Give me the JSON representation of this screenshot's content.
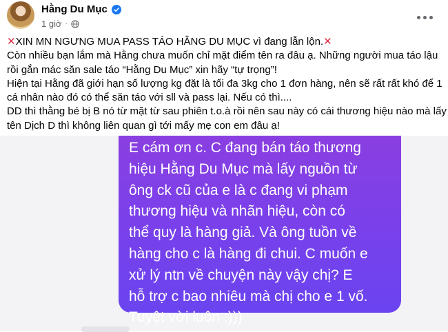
{
  "post": {
    "author": "Hằng Du Mục",
    "time": "1 giờ",
    "privacy_icon": "globe-icon",
    "more_icon": "more-options-icon",
    "lines": [
      "XIN MN NGƯNG MUA PASS TÁO HẰNG DU MỤC vì đang lẫn lộn.",
      "Còn nhiều bạn lắm mà Hằng chưa muốn chỉ mặt điểm tên ra đâu ạ. Những người mua táo lậu",
      "rồi gắn mác săn sale táo “Hằng Du Mục” xin hãy “tự trọng”!",
      "Hiện tại Hằng đã giới hạn số lượng kg đặt là tối đa 3kg cho 1 đơn hàng, nên sẽ rất rất khó để 1",
      "cá nhân nào đó có thể săn táo với sll và pass lại. Nếu có thì....",
      "DD thì thằng bé bị B nó từ mặt từ sau phiên t.o.à rồi nên sau này có cái thương hiệu nào mà lấy",
      "tên Dịch D thì không liên quan gì tới mấy mẹ con em đâu ạ!"
    ]
  },
  "message": {
    "lines": [
      "E cám ơn c. C đang bán táo thương",
      "hiệu Hằng Du Mục mà lấy nguồn từ",
      "ông ck cũ của e là c đang vi phạm",
      "thương hiệu và nhãn hiệu, còn có",
      "thể quy là hàng giả. Và ông tuồn về",
      "hàng cho c là hàng đi chui. C muốn e",
      "xử lý ntn về chuyện này vậy chị? E",
      "hỗ trợ c bao nhiêu mà chị cho e 1 vố.",
      "Tuyệt vời luôn :)))"
    ]
  },
  "colors": {
    "verified": "#1877f2",
    "x_mark": "#dd2e44",
    "bubble_top": "#8a3fe0",
    "bubble_bottom": "#6a44f0"
  }
}
